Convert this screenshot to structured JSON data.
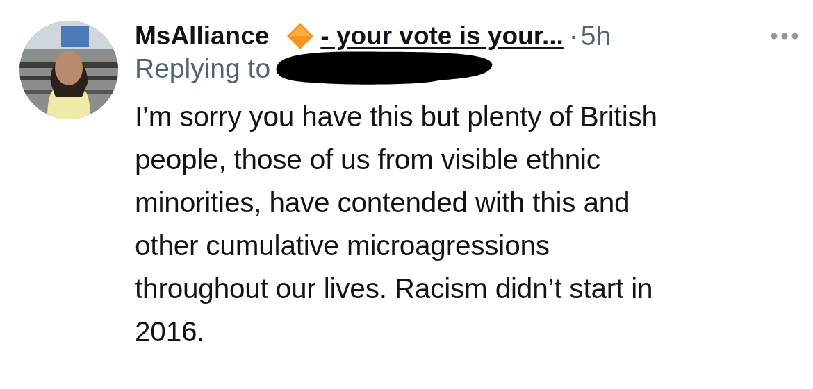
{
  "tweet": {
    "author": {
      "name": "MsAlliance",
      "name_suffix": "- your vote is your...",
      "underlined": true
    },
    "separator": "·",
    "time": "5h",
    "reply": {
      "label": "Replying to",
      "redacted": true
    },
    "text": "I’m sorry you have this but plenty of British\npeople, those of us from visible ethnic\nminorities, have contended with this and\nother cumulative microagressions\nthroughout our lives. Racism didn’t start in\n2016."
  }
}
